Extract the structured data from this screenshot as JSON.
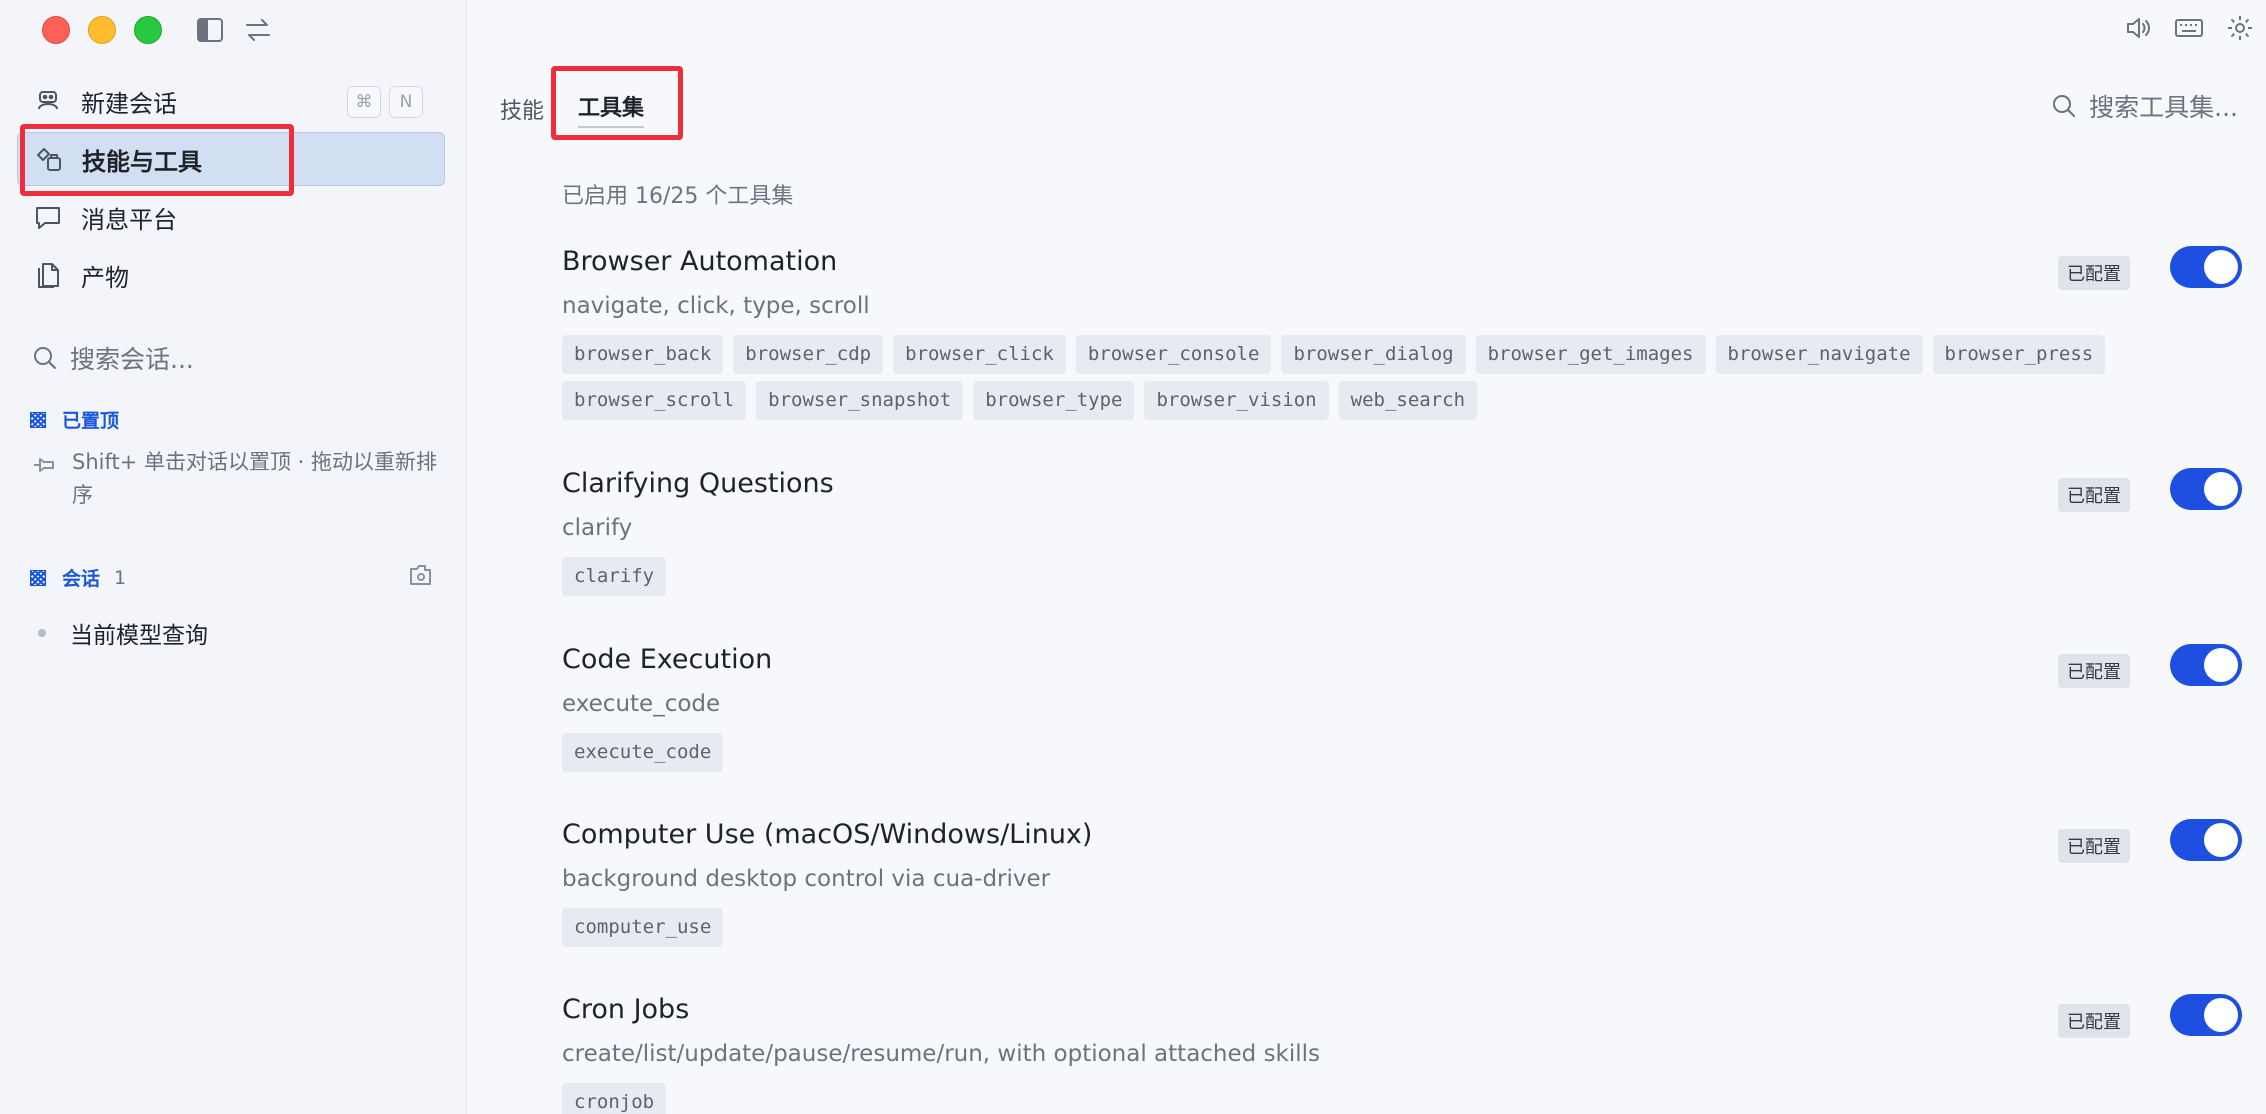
{
  "sidebar": {
    "nav": [
      {
        "label": "新建会话",
        "icon": "robot-icon"
      },
      {
        "label": "技能与工具",
        "icon": "tools-icon"
      },
      {
        "label": "消息平台",
        "icon": "chat-bubble-icon"
      },
      {
        "label": "产物",
        "icon": "document-icon"
      }
    ],
    "shortcut": {
      "modifier": "⌘",
      "key": "N"
    },
    "search_placeholder": "搜索会话...",
    "pinned": {
      "title": "已置顶",
      "hint": "Shift+ 单击对话以置顶 · 拖动以重新排序"
    },
    "conversations": {
      "title": "会话",
      "count": "1",
      "items": [
        "当前模型查询"
      ]
    }
  },
  "main": {
    "tabs": [
      "技能",
      "工具集"
    ],
    "active_tab": "工具集",
    "search_placeholder": "搜索工具集...",
    "summary": "已启用 16/25 个工具集",
    "badge_label": "已配置",
    "toolsets": [
      {
        "title": "Browser Automation",
        "desc": "navigate, click, type, scroll",
        "enabled": true,
        "tools": [
          "browser_back",
          "browser_cdp",
          "browser_click",
          "browser_console",
          "browser_dialog",
          "browser_get_images",
          "browser_navigate",
          "browser_press",
          "browser_scroll",
          "browser_snapshot",
          "browser_type",
          "browser_vision",
          "web_search"
        ]
      },
      {
        "title": "Clarifying Questions",
        "desc": "clarify",
        "enabled": true,
        "tools": [
          "clarify"
        ]
      },
      {
        "title": "Code Execution",
        "desc": "execute_code",
        "enabled": true,
        "tools": [
          "execute_code"
        ]
      },
      {
        "title": "Computer Use (macOS/Windows/Linux)",
        "desc": "background desktop control via cua-driver",
        "enabled": true,
        "tools": [
          "computer_use"
        ]
      },
      {
        "title": "Cron Jobs",
        "desc": "create/list/update/pause/resume/run, with optional attached skills",
        "enabled": true,
        "tools": [
          "cronjob"
        ]
      }
    ]
  },
  "colors": {
    "accent": "#1d4fe0",
    "highlight_box": "#ee2f3b",
    "active_nav_bg": "#d2dff3"
  }
}
